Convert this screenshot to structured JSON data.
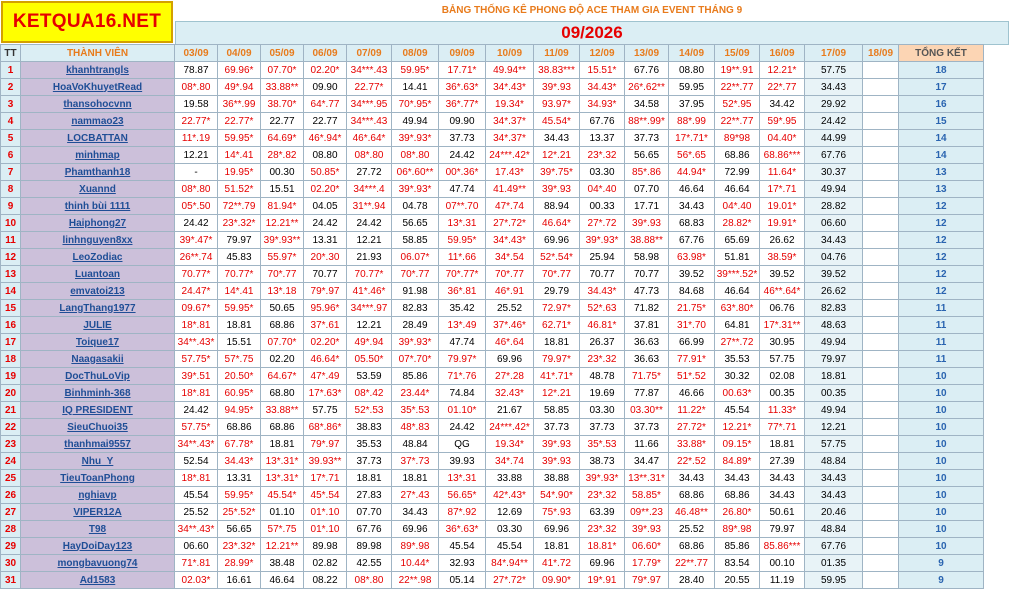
{
  "site_logo": "KETQUA16.NET",
  "page_title": "BẢNG THỐNG KÊ PHONG ĐỘ ACE THAM GIA EVENT THÁNG 9",
  "month_label": "09/2026",
  "colors": {
    "logo_bg": "#ffff00",
    "logo_text": "#e60000",
    "header_bg": "#dbeef4",
    "name_bg": "#ccc0da",
    "total_bg": "#fcd5b4"
  },
  "columns": {
    "tt": "TT",
    "member": "THÀNH VIÊN",
    "dates": [
      "03/09",
      "04/09",
      "05/09",
      "06/09",
      "07/09",
      "08/09",
      "09/09",
      "10/09",
      "11/09",
      "12/09",
      "13/09",
      "14/09",
      "15/09",
      "16/09",
      "17/09",
      "18/09"
    ],
    "total": "TỔNG KẾT"
  },
  "rows": [
    {
      "tt": "1",
      "name": "khanhtrangls",
      "vals": [
        "78.87",
        "69.96*",
        "07.70*",
        "02.20*",
        "34***.43",
        "59.95*",
        "17.71*",
        "49.94**",
        "38.83***",
        "15.51*",
        "67.76",
        "08.80",
        "19**.91",
        "12.21*",
        "57.75",
        ""
      ],
      "total": "18"
    },
    {
      "tt": "2",
      "name": "HoaVoKhuyetRead",
      "vals": [
        "08*.80",
        "49*.94",
        "33.88**",
        "09.90",
        "22.77*",
        "14.41",
        "36*.63*",
        "34*.43*",
        "39*.93",
        "34.43*",
        "26*.62**",
        "59.95",
        "22**.77",
        "22*.77",
        "34.43",
        ""
      ],
      "total": "17"
    },
    {
      "tt": "3",
      "name": "thansohocvnn",
      "vals": [
        "19.58",
        "36**.99",
        "38.70*",
        "64*.77",
        "34***.95",
        "70*.95*",
        "36*.77*",
        "19.34*",
        "93.97*",
        "34.93*",
        "34.58",
        "37.95",
        "52*.95",
        "34.42",
        "29.92",
        ""
      ],
      "total": "16"
    },
    {
      "tt": "4",
      "name": "nammao23",
      "vals": [
        "22.77*",
        "22.77*",
        "22.77",
        "22.77",
        "34***.43",
        "49.94",
        "09.90",
        "34*.37*",
        "45.54*",
        "67.76",
        "88**.99*",
        "88*.99",
        "22**.77",
        "59*.95",
        "24.42",
        ""
      ],
      "total": "15"
    },
    {
      "tt": "5",
      "name": "LOCBATTAN",
      "vals": [
        "11*.19",
        "59.95*",
        "64.69*",
        "46*.94*",
        "46*.64*",
        "39*.93*",
        "37.73",
        "34*.37*",
        "34.43",
        "13.37",
        "37.73",
        "17*.71*",
        "89*98",
        "04.40*",
        "44.99",
        ""
      ],
      "total": "14"
    },
    {
      "tt": "6",
      "name": "minhmap",
      "vals": [
        "12.21",
        "14*.41",
        "28*.82",
        "08.80",
        "08*.80",
        "08*.80",
        "24.42",
        "24***.42*",
        "12*.21",
        "23*.32",
        "56.65",
        "56*.65",
        "68.86",
        "68.86***",
        "67.76",
        ""
      ],
      "total": "14"
    },
    {
      "tt": "7",
      "name": "Phamthanh18",
      "vals": [
        "-",
        "19.95*",
        "00.30",
        "50.85*",
        "27.72",
        "06*.60**",
        "00*.36*",
        "17.43*",
        "39*.75*",
        "03.30",
        "85*.86",
        "44.94*",
        "72.99",
        "11.64*",
        "30.37",
        ""
      ],
      "total": "13"
    },
    {
      "tt": "8",
      "name": "Xuannd",
      "vals": [
        "08*.80",
        "51.52*",
        "15.51",
        "02.20*",
        "34***.4",
        "39*.93*",
        "47.74",
        "41.49**",
        "39*.93",
        "04*.40",
        "07.70",
        "46.64",
        "46.64",
        "17*.71",
        "49.94",
        ""
      ],
      "total": "13"
    },
    {
      "tt": "9",
      "name": "thinh bùi 1111",
      "vals": [
        "05*.50",
        "72**.79",
        "81.94*",
        "04.05",
        "31**.94",
        "04.78",
        "07**.70",
        "47*.74",
        "88.94",
        "00.33",
        "17.71",
        "34.43",
        "04*.40",
        "19.01*",
        "28.82",
        ""
      ],
      "total": "12"
    },
    {
      "tt": "10",
      "name": "Haiphong27",
      "vals": [
        "24.42",
        "23*.32*",
        "12.21**",
        "24.42",
        "24.42",
        "56.65",
        "13*.31",
        "27*.72*",
        "46.64*",
        "27*.72",
        "39*.93",
        "68.83",
        "28.82*",
        "19.91*",
        "06.60",
        ""
      ],
      "total": "12"
    },
    {
      "tt": "11",
      "name": "linhnguyen8xx",
      "vals": [
        "39*.47*",
        "79.97",
        "39*.93**",
        "13.31",
        "12.21",
        "58.85",
        "59.95*",
        "34*.43*",
        "69.96",
        "39*.93*",
        "38.88**",
        "67.76",
        "65.69",
        "26.62",
        "34.43",
        ""
      ],
      "total": "12"
    },
    {
      "tt": "12",
      "name": "LeoZodiac",
      "vals": [
        "26**.74",
        "45.83",
        "55.97*",
        "20*.30",
        "21.93",
        "06.07*",
        "11*.66",
        "34*.54",
        "52*.54*",
        "25.94",
        "58.98",
        "63.98*",
        "51.81",
        "38.59*",
        "04.76",
        ""
      ],
      "total": "12"
    },
    {
      "tt": "13",
      "name": "Luantoan",
      "vals": [
        "70.77*",
        "70.77*",
        "70*.77",
        "70.77",
        "70.77*",
        "70*.77",
        "70*.77*",
        "70*.77",
        "70*.77",
        "70.77",
        "70.77",
        "39.52",
        "39***.52*",
        "39.52",
        "39.52",
        ""
      ],
      "total": "12"
    },
    {
      "tt": "14",
      "name": "emvatoi213",
      "vals": [
        "24.47*",
        "14*.41",
        "13*.18",
        "79*.97",
        "41*.46*",
        "91.98",
        "36*.81",
        "46*.91",
        "29.79",
        "34.43*",
        "47.73",
        "84.68",
        "46.64",
        "46**.64*",
        "26.62",
        ""
      ],
      "total": "12"
    },
    {
      "tt": "15",
      "name": "LangThang1977",
      "vals": [
        "09.67*",
        "59.95*",
        "50.65",
        "95.96*",
        "34***.97",
        "82.83",
        "35.42",
        "25.52",
        "72.97*",
        "52*.63",
        "71.82",
        "21.75*",
        "63*.80*",
        "06.76",
        "82.83",
        ""
      ],
      "total": "11"
    },
    {
      "tt": "16",
      "name": "JULIE",
      "vals": [
        "18*.81",
        "18.81",
        "68.86",
        "37*.61",
        "12.21",
        "28.49",
        "13*.49",
        "37*.46*",
        "62.71*",
        "46.81*",
        "37.81",
        "31*.70",
        "64.81",
        "17*.31**",
        "48.63",
        ""
      ],
      "total": "11"
    },
    {
      "tt": "17",
      "name": "Toique17",
      "vals": [
        "34**.43*",
        "15.51",
        "07.70*",
        "02.20*",
        "49*.94",
        "39*.93*",
        "47.74",
        "46*.64",
        "18.81",
        "26.37",
        "36.63",
        "66.99",
        "27**.72",
        "30.95",
        "49.94",
        ""
      ],
      "total": "11"
    },
    {
      "tt": "18",
      "name": "Naagasakii",
      "vals": [
        "57.75*",
        "57*.75",
        "02.20",
        "46.64*",
        "05.50*",
        "07*.70*",
        "79.97*",
        "69.96",
        "79.97*",
        "23*.32",
        "36.63",
        "77.91*",
        "35.53",
        "57.75",
        "79.97",
        ""
      ],
      "total": "11"
    },
    {
      "tt": "19",
      "name": "DocThuLoVip",
      "vals": [
        "39*.51",
        "20.50*",
        "64.67*",
        "47*.49",
        "53.59",
        "85.86",
        "71*.76",
        "27*.28",
        "41*.71*",
        "48.78",
        "71.75*",
        "51*.52",
        "30.32",
        "02.08",
        "18.81",
        ""
      ],
      "total": "10"
    },
    {
      "tt": "20",
      "name": "Binhminh-368",
      "vals": [
        "18*.81",
        "60.95*",
        "68.80",
        "17*.63*",
        "08*.42",
        "23.44*",
        "74.84",
        "32.43*",
        "12*.21",
        "19.69",
        "77.87",
        "46.66",
        "00.63*",
        "00.35",
        "00.35",
        ""
      ],
      "total": "10"
    },
    {
      "tt": "21",
      "name": "IQ PRESIDENT",
      "vals": [
        "24.42",
        "94.95*",
        "33.88**",
        "57.75",
        "52*.53",
        "35*.53",
        "01.10*",
        "21.67",
        "58.85",
        "03.30",
        "03.30**",
        "11.22*",
        "45.54",
        "11.33*",
        "49.94",
        ""
      ],
      "total": "10"
    },
    {
      "tt": "22",
      "name": "SieuChuoi35",
      "vals": [
        "57.75*",
        "68.86",
        "68.86",
        "68*.86*",
        "38.83",
        "48*.83",
        "24.42",
        "24***.42*",
        "37.73",
        "37.73",
        "37.73",
        "27.72*",
        "12.21*",
        "77*.71",
        "12.21",
        ""
      ],
      "total": "10"
    },
    {
      "tt": "23",
      "name": "thanhmai9557",
      "vals": [
        "34**.43*",
        "67.78*",
        "18.81",
        "79*.97",
        "35.53",
        "48.84",
        "QG",
        "19.34*",
        "39*.93",
        "35*.53",
        "11.66",
        "33.88*",
        "09.15*",
        "18.81",
        "57.75",
        ""
      ],
      "total": "10"
    },
    {
      "tt": "24",
      "name": "Nhu_Y",
      "vals": [
        "52.54",
        "34.43*",
        "13*.31*",
        "39.93**",
        "37.73",
        "37*.73",
        "39.93",
        "34*.74",
        "39*.93",
        "38.73",
        "34.47",
        "22*.52",
        "84.89*",
        "27.39",
        "48.84",
        ""
      ],
      "total": "10"
    },
    {
      "tt": "25",
      "name": "TieuToanPhong",
      "vals": [
        "18*.81",
        "13.31",
        "13*.31*",
        "17*.71",
        "18.81",
        "18.81",
        "13*.31",
        "33.88",
        "38.88",
        "39*.93*",
        "13**.31*",
        "34.43",
        "34.43",
        "34.43",
        "34.43",
        ""
      ],
      "total": "10"
    },
    {
      "tt": "26",
      "name": "nghiavp",
      "vals": [
        "45.54",
        "59.95*",
        "45.54*",
        "45*.54",
        "27.83",
        "27*.43",
        "56.65*",
        "42*.43*",
        "54*.90*",
        "23*.32",
        "58.85*",
        "68.86",
        "68.86",
        "34.43",
        "34.43",
        ""
      ],
      "total": "10"
    },
    {
      "tt": "27",
      "name": "VIPER12A",
      "vals": [
        "25.52",
        "25*.52*",
        "01.10",
        "01*.10",
        "07.70",
        "34.43",
        "87*.92",
        "12.69",
        "75*.93",
        "63.39",
        "09**.23",
        "46.48**",
        "26.80*",
        "50.61",
        "20.46",
        ""
      ],
      "total": "10"
    },
    {
      "tt": "28",
      "name": "T98",
      "vals": [
        "34**.43*",
        "56.65",
        "57*.75",
        "01*.10",
        "67.76",
        "69.96",
        "36*.63*",
        "03.30",
        "69.96",
        "23*.32",
        "39*.93",
        "25.52",
        "89*.98",
        "79.97",
        "48.84",
        ""
      ],
      "total": "10"
    },
    {
      "tt": "29",
      "name": "HayDoiDay123",
      "vals": [
        "06.60",
        "23*.32*",
        "12.21**",
        "89.98",
        "89.98",
        "89*.98",
        "45.54",
        "45.54",
        "18.81",
        "18.81*",
        "06.60*",
        "68.86",
        "85.86",
        "85.86***",
        "67.76",
        ""
      ],
      "total": "10"
    },
    {
      "tt": "30",
      "name": "mongbavuong74",
      "vals": [
        "71*.81",
        "28.99*",
        "38.48",
        "02.82",
        "42.55",
        "10.44*",
        "32.93",
        "84*.94**",
        "41*.72",
        "69.96",
        "17.79*",
        "22**.77",
        "83.54",
        "00.10",
        "01.35",
        ""
      ],
      "total": "9"
    },
    {
      "tt": "31",
      "name": "Ad1583",
      "vals": [
        "02.03*",
        "16.61",
        "46.64",
        "08.22",
        "08*.80",
        "22**.98",
        "05.14",
        "27*.72*",
        "09.90*",
        "19*.91",
        "79*.97",
        "28.40",
        "20.55",
        "11.19",
        "59.95",
        ""
      ],
      "total": "9"
    }
  ]
}
